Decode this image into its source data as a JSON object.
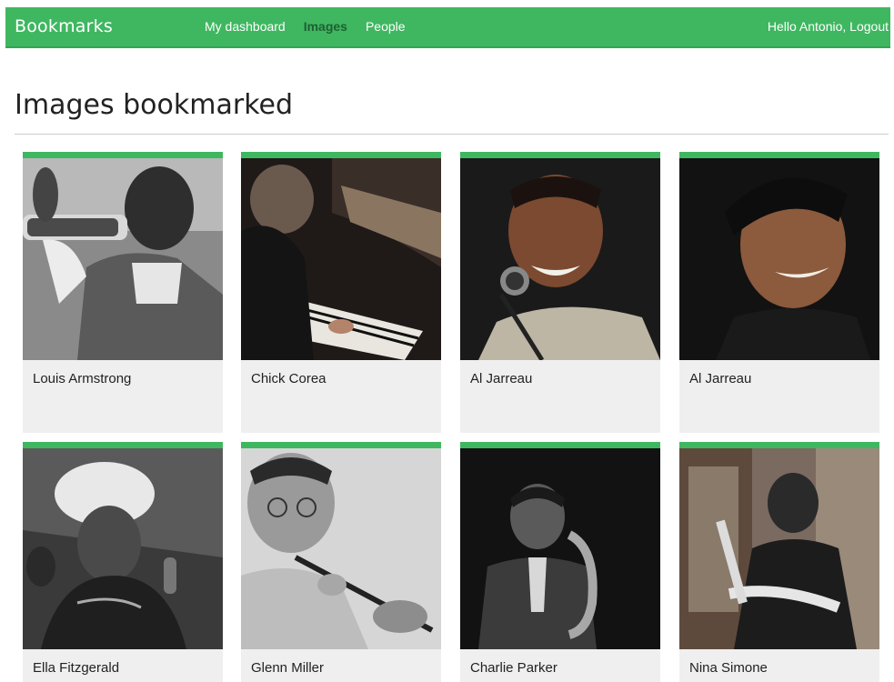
{
  "topbar": {
    "brand": "Bookmarks",
    "nav": [
      {
        "label": "My dashboard",
        "active": false
      },
      {
        "label": "Images",
        "active": true
      },
      {
        "label": "People",
        "active": false
      }
    ],
    "greeting": "Hello Antonio,",
    "logout": "Logout",
    "accent_color": "#3fb760"
  },
  "page": {
    "title": "Images bookmarked"
  },
  "images": [
    {
      "title": "Louis Armstrong"
    },
    {
      "title": "Chick Corea"
    },
    {
      "title": "Al Jarreau"
    },
    {
      "title": "Al Jarreau"
    },
    {
      "title": "Ella Fitzgerald"
    },
    {
      "title": "Glenn Miller"
    },
    {
      "title": "Charlie Parker"
    },
    {
      "title": "Nina Simone"
    }
  ]
}
